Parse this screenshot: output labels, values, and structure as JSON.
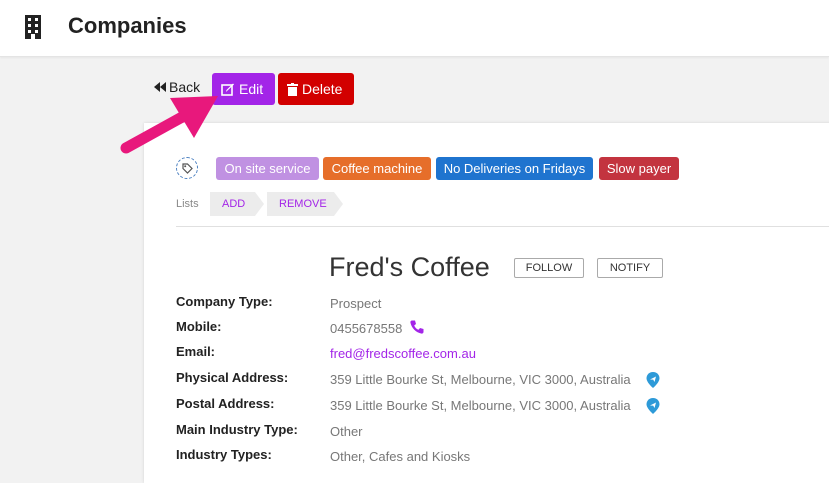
{
  "header": {
    "title": "Companies",
    "icon": "building-icon"
  },
  "actions": {
    "back_label": "Back",
    "edit_label": "Edit",
    "delete_label": "Delete",
    "edit_color": "#a325e8",
    "delete_color": "#d20000"
  },
  "tags": [
    {
      "label": "On site service",
      "color": "#c091e2"
    },
    {
      "label": "Coffee machine",
      "color": "#e66e2a"
    },
    {
      "label": "No Deliveries on Fridays",
      "color": "#1f74cf"
    },
    {
      "label": "Slow payer",
      "color": "#c3343f"
    }
  ],
  "lists": {
    "label": "Lists",
    "add_label": "ADD",
    "remove_label": "REMOVE"
  },
  "company": {
    "name": "Fred's Coffee",
    "follow_label": "FOLLOW",
    "notify_label": "NOTIFY"
  },
  "fields": [
    {
      "label": "Company Type:",
      "value": "Prospect"
    },
    {
      "label": "Mobile:",
      "value": "0455678558",
      "icon": "phone-icon"
    },
    {
      "label": "Email:",
      "value": "fred@fredscoffee.com.au"
    },
    {
      "label": "Physical Address:",
      "value": "359 Little Bourke St, Melbourne, VIC 3000, Australia",
      "icon": "map-pin-icon"
    },
    {
      "label": "Postal Address:",
      "value": "359 Little Bourke St, Melbourne, VIC 3000, Australia",
      "icon": "map-pin-icon"
    },
    {
      "label": "Main Industry Type:",
      "value": "Other"
    },
    {
      "label": "Industry Types:",
      "value": "Other, Cafes and Kiosks"
    }
  ],
  "annotation": {
    "icon": "pointer-arrow",
    "color": "#e8187c"
  }
}
